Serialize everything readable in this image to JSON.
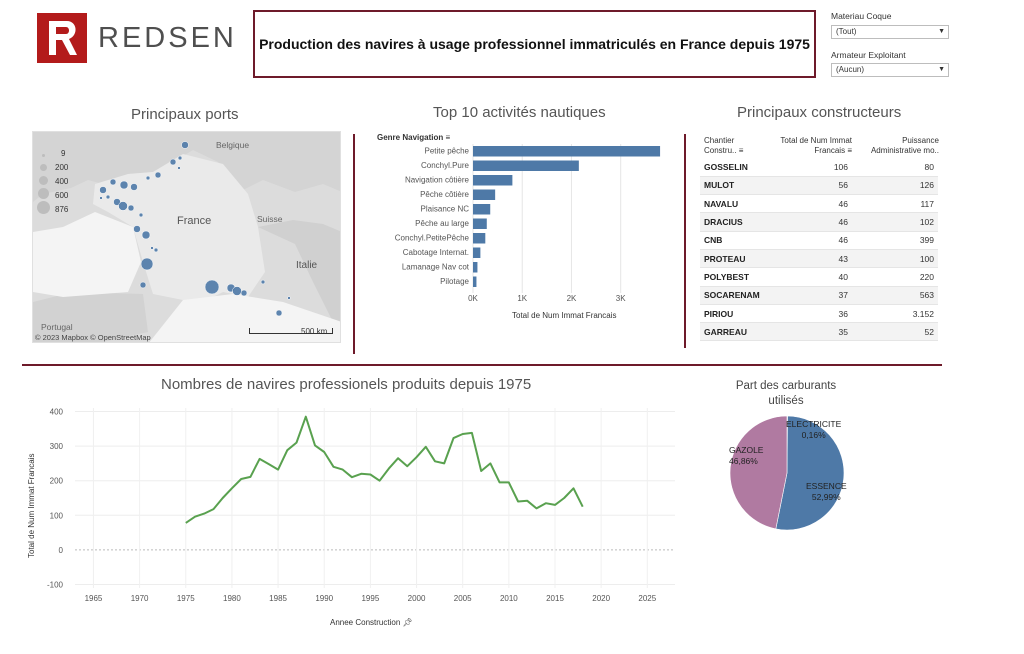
{
  "brand": {
    "name": "REDSEN",
    "accent": "#b31b1b"
  },
  "header": {
    "title": "Production des navires à usage professionnel immatriculés en France depuis 1975"
  },
  "filters": {
    "materiau": {
      "label": "Materiau Coque",
      "value": "(Tout)"
    },
    "armateur": {
      "label": "Armateur Exploitant",
      "value": "(Aucun)"
    }
  },
  "ports": {
    "title": "Principaux ports",
    "legend": [
      "9",
      "200",
      "400",
      "600",
      "876"
    ],
    "labels": {
      "belgique": "Belgique",
      "france": "France",
      "suisse": "Suisse",
      "italie": "Italie",
      "portugal": "Portugal"
    },
    "scale": "500 km",
    "attribution": "© 2023 Mapbox © OpenStreetMap"
  },
  "activities": {
    "title": "Top 10 activités nautiques",
    "dimension_label": "Genre Navigation",
    "axis_label": "Total de Num Immat Francais",
    "ticks": [
      "0K",
      "1K",
      "2K",
      "3K"
    ]
  },
  "constructors": {
    "title": "Principaux constructeurs",
    "headers": [
      "Chantier Constru..",
      "Total de Num Immat Francais",
      "Puissance Administrative mo.."
    ],
    "rows": [
      [
        "GOSSELIN",
        "106",
        "80"
      ],
      [
        "MULOT",
        "56",
        "126"
      ],
      [
        "NAVALU",
        "46",
        "117"
      ],
      [
        "DRACIUS",
        "46",
        "102"
      ],
      [
        "CNB",
        "46",
        "399"
      ],
      [
        "PROTEAU",
        "43",
        "100"
      ],
      [
        "POLYBEST",
        "40",
        "220"
      ],
      [
        "SOCARENAM",
        "37",
        "563"
      ],
      [
        "PIRIOU",
        "36",
        "3.152"
      ],
      [
        "GARREAU",
        "35",
        "52"
      ]
    ]
  },
  "production": {
    "title": "Nombres de navires professionels produits depuis 1975",
    "ylabel": "Total de Num Immat Francais",
    "xlabel": "Annee Construction",
    "yticks": [
      "400",
      "300",
      "200",
      "100",
      "0",
      "-100"
    ],
    "xticks": [
      "1965",
      "1970",
      "1975",
      "1980",
      "1985",
      "1990",
      "1995",
      "2000",
      "2005",
      "2010",
      "2015",
      "2020",
      "2025"
    ]
  },
  "fuels": {
    "title_line1": "Part des carburants",
    "title_line2": "utilisés",
    "slices": [
      {
        "name": "ELECTRICITE",
        "pct": "0,16%",
        "value": 0.16,
        "color": "#4e79a7"
      },
      {
        "name": "ESSENCE",
        "pct": "52,99%",
        "value": 52.99,
        "color": "#4e79a7"
      },
      {
        "name": "GAZOLE",
        "pct": "46,86%",
        "value": 46.86,
        "color": "#b07aa1"
      }
    ]
  },
  "chart_data": [
    {
      "type": "bar",
      "title": "Top 10 activités nautiques",
      "xlabel": "Total de Num Immat Francais",
      "ylabel": "Genre Navigation",
      "categories": [
        "Petite pêche",
        "Conchyl.Pure",
        "Navigation côtière",
        "Pêche côtière",
        "Plaisance NC",
        "Pêche au large",
        "Conchyl.PetitePêche",
        "Cabotage Internat.",
        "Lamanage Nav cot",
        "Pilotage"
      ],
      "values": [
        3800,
        2150,
        800,
        450,
        350,
        280,
        250,
        150,
        90,
        70
      ],
      "xlim": [
        0,
        3900
      ],
      "color": "#4e79a7"
    },
    {
      "type": "line",
      "title": "Nombres de navires professionels produits depuis 1975",
      "xlabel": "Annee Construction",
      "ylabel": "Total de Num Immat Francais",
      "x": [
        1975,
        1976,
        1977,
        1978,
        1979,
        1980,
        1981,
        1982,
        1983,
        1984,
        1985,
        1986,
        1987,
        1988,
        1989,
        1990,
        1991,
        1992,
        1993,
        1994,
        1995,
        1996,
        1997,
        1998,
        1999,
        2000,
        2001,
        2002,
        2003,
        2004,
        2005,
        2006,
        2007,
        2008,
        2009,
        2010,
        2011,
        2012,
        2013,
        2014,
        2015,
        2016,
        2017,
        2018
      ],
      "y": [
        78,
        96,
        105,
        118,
        150,
        178,
        205,
        211,
        263,
        248,
        232,
        288,
        310,
        385,
        302,
        283,
        240,
        232,
        210,
        220,
        218,
        200,
        235,
        265,
        242,
        268,
        298,
        256,
        250,
        323,
        335,
        338,
        228,
        250,
        195,
        195,
        140,
        142,
        120,
        135,
        130,
        150,
        178,
        125
      ],
      "xlim": [
        1963,
        2028
      ],
      "ylim": [
        -110,
        410
      ],
      "color": "#59a14f"
    },
    {
      "type": "pie",
      "title": "Part des carburants utilisés",
      "labels": [
        "ELECTRICITE",
        "ESSENCE",
        "GAZOLE"
      ],
      "values": [
        0.16,
        52.99,
        46.86
      ]
    }
  ]
}
